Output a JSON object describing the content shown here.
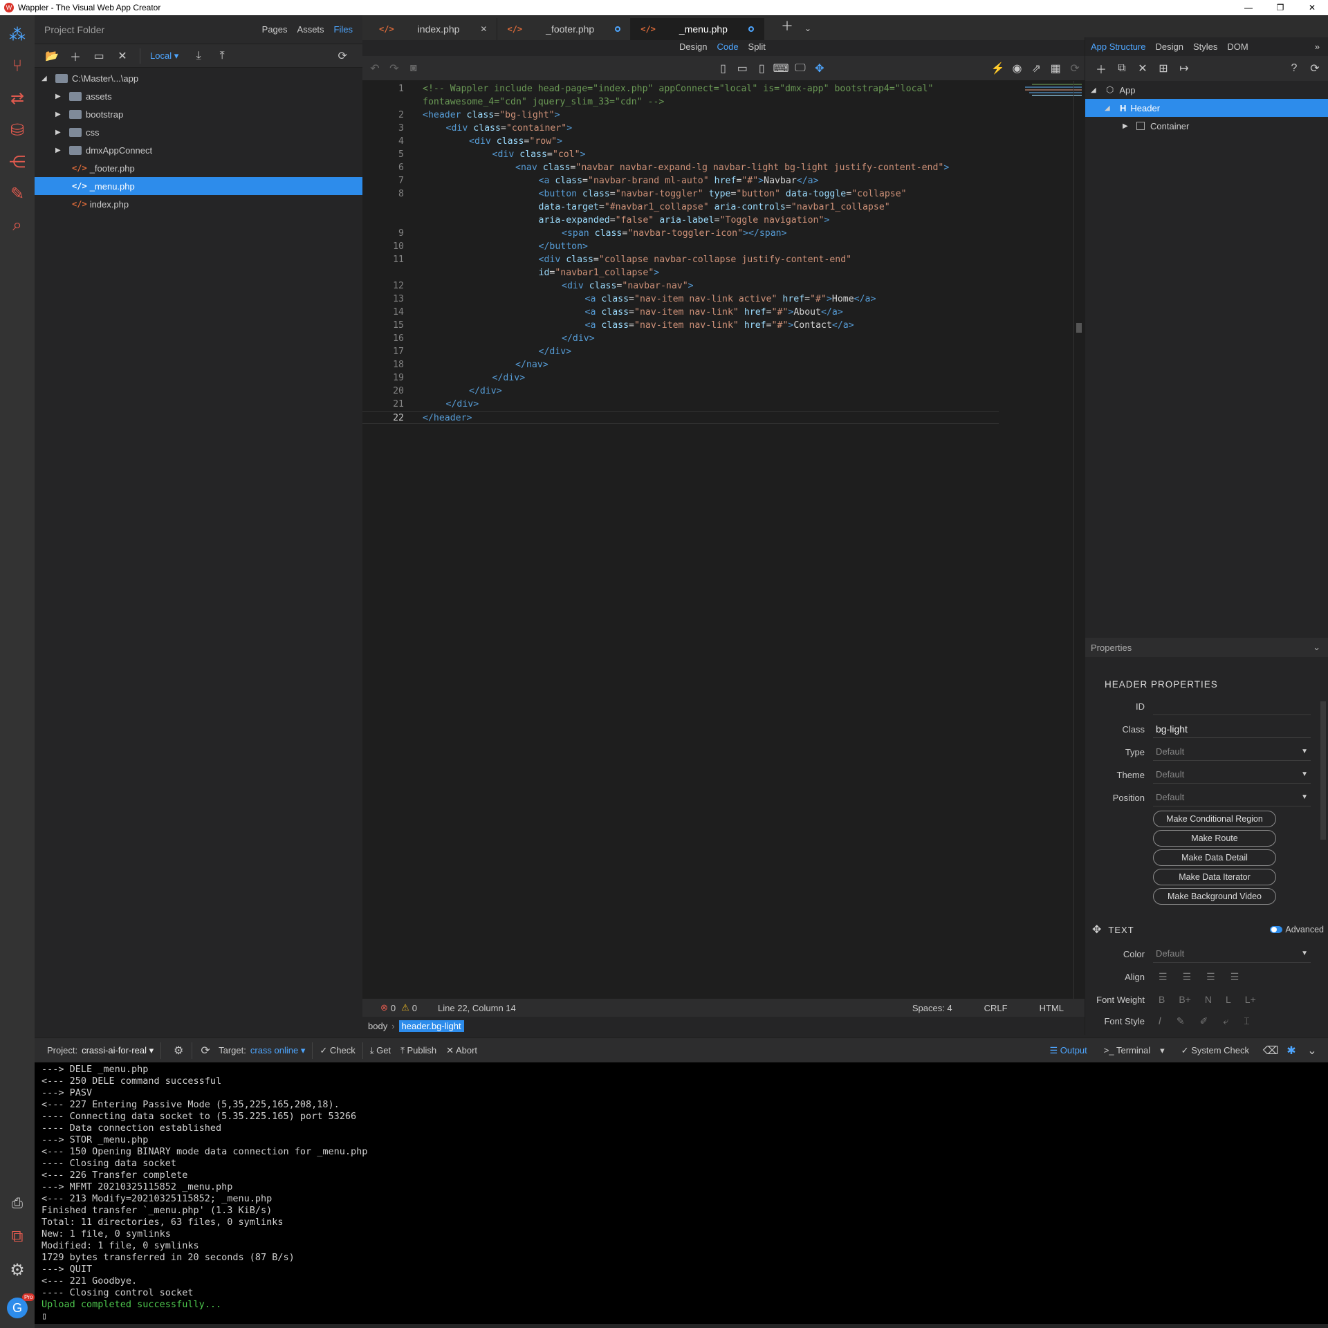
{
  "window": {
    "title": "Wappler - The Visual Web App Creator",
    "min": "—",
    "max": "❐",
    "close": "✕"
  },
  "left_panel": {
    "title": "Project Folder",
    "tabs": [
      "Pages",
      "Assets",
      "Files"
    ],
    "target_select": "Local",
    "tree": [
      {
        "label": "C:\\Master\\...\\app",
        "type": "root"
      },
      {
        "label": "assets",
        "type": "folder"
      },
      {
        "label": "bootstrap",
        "type": "folder"
      },
      {
        "label": "css",
        "type": "folder"
      },
      {
        "label": "dmxAppConnect",
        "type": "folder"
      },
      {
        "label": "_footer.php",
        "type": "file"
      },
      {
        "label": "_menu.php",
        "type": "file",
        "selected": true
      },
      {
        "label": "index.php",
        "type": "file"
      }
    ]
  },
  "editor_tabs": [
    {
      "label": "index.php",
      "state": "close"
    },
    {
      "label": "_footer.php",
      "state": "modified"
    },
    {
      "label": "_menu.php",
      "state": "modified",
      "active": true
    }
  ],
  "view_modes": [
    "Design",
    "Code",
    "Split"
  ],
  "code_lines": [
    {
      "n": "1",
      "indent": 0,
      "html": "<span class='cmt'>&lt;!-- Wappler include head-page=\"index.php\" appConnect=\"local\" is=\"dmx-app\" bootstrap4=\"local\"</span>"
    },
    {
      "n": "",
      "indent": 0,
      "html": "<span class='cmt'>fontawesome_4=\"cdn\" jquery_slim_33=\"cdn\" --&gt;</span>"
    },
    {
      "n": "2",
      "indent": 0,
      "html": "<span class='tag'>&lt;header</span> <span class='attr'>class</span><span class='txt'>=</span><span class='val'>\"bg-light\"</span><span class='tag'>&gt;</span>"
    },
    {
      "n": "3",
      "indent": 1,
      "html": "<span class='tag'>&lt;div</span> <span class='attr'>class</span><span class='txt'>=</span><span class='val'>\"container\"</span><span class='tag'>&gt;</span>"
    },
    {
      "n": "4",
      "indent": 2,
      "html": "<span class='tag'>&lt;div</span> <span class='attr'>class</span><span class='txt'>=</span><span class='val'>\"row\"</span><span class='tag'>&gt;</span>"
    },
    {
      "n": "5",
      "indent": 3,
      "html": "<span class='tag'>&lt;div</span> <span class='attr'>class</span><span class='txt'>=</span><span class='val'>\"col\"</span><span class='tag'>&gt;</span>"
    },
    {
      "n": "6",
      "indent": 4,
      "html": "<span class='tag'>&lt;nav</span> <span class='attr'>class</span><span class='txt'>=</span><span class='val'>\"navbar navbar-expand-lg navbar-light bg-light justify-content-end\"</span><span class='tag'>&gt;</span>"
    },
    {
      "n": "7",
      "indent": 5,
      "html": "<span class='tag'>&lt;a</span> <span class='attr'>class</span><span class='txt'>=</span><span class='val'>\"navbar-brand ml-auto\"</span> <span class='attr'>href</span><span class='txt'>=</span><span class='val'>\"#\"</span><span class='tag'>&gt;</span><span class='txt'>Navbar</span><span class='tag'>&lt;/a&gt;</span>"
    },
    {
      "n": "8",
      "indent": 5,
      "html": "<span class='tag'>&lt;button</span> <span class='attr'>class</span><span class='txt'>=</span><span class='val'>\"navbar-toggler\"</span> <span class='attr'>type</span><span class='txt'>=</span><span class='val'>\"button\"</span> <span class='attr'>data-toggle</span><span class='txt'>=</span><span class='val'>\"collapse\"</span>"
    },
    {
      "n": "",
      "indent": 5,
      "html": "<span class='attr'>data-target</span><span class='txt'>=</span><span class='val'>\"#navbar1_collapse\"</span> <span class='attr'>aria-controls</span><span class='txt'>=</span><span class='val'>\"navbar1_collapse\"</span>"
    },
    {
      "n": "",
      "indent": 5,
      "html": "<span class='attr'>aria-expanded</span><span class='txt'>=</span><span class='val'>\"false\"</span> <span class='attr'>aria-label</span><span class='txt'>=</span><span class='val'>\"Toggle navigation\"</span><span class='tag'>&gt;</span>"
    },
    {
      "n": "9",
      "indent": 6,
      "html": "<span class='tag'>&lt;span</span> <span class='attr'>class</span><span class='txt'>=</span><span class='val'>\"navbar-toggler-icon\"</span><span class='tag'>&gt;&lt;/span&gt;</span>"
    },
    {
      "n": "10",
      "indent": 5,
      "html": "<span class='tag'>&lt;/button&gt;</span>"
    },
    {
      "n": "11",
      "indent": 5,
      "html": "<span class='tag'>&lt;div</span> <span class='attr'>class</span><span class='txt'>=</span><span class='val'>\"collapse navbar-collapse justify-content-end\"</span>"
    },
    {
      "n": "",
      "indent": 5,
      "html": "<span class='attr'>id</span><span class='txt'>=</span><span class='val'>\"navbar1_collapse\"</span><span class='tag'>&gt;</span>"
    },
    {
      "n": "12",
      "indent": 6,
      "html": "<span class='tag'>&lt;div</span> <span class='attr'>class</span><span class='txt'>=</span><span class='val'>\"navbar-nav\"</span><span class='tag'>&gt;</span>"
    },
    {
      "n": "13",
      "indent": 7,
      "html": "<span class='tag'>&lt;a</span> <span class='attr'>class</span><span class='txt'>=</span><span class='val'>\"nav-item nav-link active\"</span> <span class='attr'>href</span><span class='txt'>=</span><span class='val'>\"#\"</span><span class='tag'>&gt;</span><span class='txt'>Home</span><span class='tag'>&lt;/a&gt;</span>"
    },
    {
      "n": "14",
      "indent": 7,
      "html": "<span class='tag'>&lt;a</span> <span class='attr'>class</span><span class='txt'>=</span><span class='val'>\"nav-item nav-link\"</span> <span class='attr'>href</span><span class='txt'>=</span><span class='val'>\"#\"</span><span class='tag'>&gt;</span><span class='txt'>About</span><span class='tag'>&lt;/a&gt;</span>"
    },
    {
      "n": "15",
      "indent": 7,
      "html": "<span class='tag'>&lt;a</span> <span class='attr'>class</span><span class='txt'>=</span><span class='val'>\"nav-item nav-link\"</span> <span class='attr'>href</span><span class='txt'>=</span><span class='val'>\"#\"</span><span class='tag'>&gt;</span><span class='txt'>Contact</span><span class='tag'>&lt;/a&gt;</span>"
    },
    {
      "n": "16",
      "indent": 6,
      "html": "<span class='tag'>&lt;/div&gt;</span>"
    },
    {
      "n": "17",
      "indent": 5,
      "html": "<span class='tag'>&lt;/div&gt;</span>"
    },
    {
      "n": "18",
      "indent": 4,
      "html": "<span class='tag'>&lt;/nav&gt;</span>"
    },
    {
      "n": "19",
      "indent": 3,
      "html": "<span class='tag'>&lt;/div&gt;</span>"
    },
    {
      "n": "20",
      "indent": 2,
      "html": "<span class='tag'>&lt;/div&gt;</span>"
    },
    {
      "n": "21",
      "indent": 1,
      "html": "<span class='tag'>&lt;/div&gt;</span>"
    },
    {
      "n": "22",
      "indent": 0,
      "html": "<span class='tag'>&lt;/header&gt;</span>"
    }
  ],
  "status": {
    "errors": "0",
    "warnings": "0",
    "position": "Line 22, Column 14",
    "spaces": "Spaces: 4",
    "eol": "CRLF",
    "lang": "HTML"
  },
  "breadcrumb": [
    "body",
    "header.bg-light"
  ],
  "right_panel": {
    "tabs": [
      "App Structure",
      "Design",
      "Styles",
      "DOM"
    ],
    "tree": [
      {
        "label": "App"
      },
      {
        "label": "Header",
        "selected": true
      },
      {
        "label": "Container"
      }
    ],
    "properties_title": "Properties",
    "section_title": "HEADER PROPERTIES",
    "fields": [
      {
        "label": "ID",
        "value": "",
        "placeholder": ""
      },
      {
        "label": "Class",
        "value": "bg-light"
      },
      {
        "label": "Type",
        "value": "Default",
        "dropdown": true
      },
      {
        "label": "Theme",
        "value": "Default",
        "dropdown": true
      },
      {
        "label": "Position",
        "value": "Default",
        "dropdown": true
      }
    ],
    "buttons": [
      "Make Conditional Region",
      "Make Route",
      "Make Data Detail",
      "Make Data Iterator",
      "Make Background Video"
    ],
    "text_section": "TEXT",
    "advanced_label": "Advanced",
    "color_label": "Color",
    "color_value": "Default",
    "align_label": "Align",
    "font_weight_label": "Font Weight",
    "font_weight_options": [
      "B",
      "B+",
      "N",
      "L",
      "L+"
    ],
    "font_style_label": "Font Style"
  },
  "bottom_bar": {
    "project_label": "Project:",
    "project_value": "crassi-ai-for-real",
    "target_label": "Target:",
    "target_value": "crass online",
    "actions": [
      "Check",
      "Get",
      "Publish",
      "Abort"
    ],
    "output_tab": "Output",
    "terminal_tab": "Terminal",
    "system_check": "System Check"
  },
  "output_lines": [
    "---> DELE _menu.php",
    "<--- 250 DELE command successful",
    "---> PASV",
    "<--- 227 Entering Passive Mode (5,35,225,165,208,18).",
    "---- Connecting data socket to (5.35.225.165) port 53266",
    "---- Data connection established",
    "---> STOR _menu.php",
    "<--- 150 Opening BINARY mode data connection for _menu.php",
    "---- Closing data socket",
    "<--- 226 Transfer complete",
    "---> MFMT 20210325115852 _menu.php",
    "<--- 213 Modify=20210325115852; _menu.php",
    "Finished transfer `_menu.php' (1.3 KiB/s)",
    "Total: 11 directories, 63 files, 0 symlinks",
    "New: 1 file, 0 symlinks",
    "Modified: 1 file, 0 symlinks",
    "1729 bytes transferred in 20 seconds (87 B/s)",
    "---> QUIT",
    "<--- 221 Goodbye.",
    "---- Closing control socket"
  ],
  "output_success": "Upload completed successfully...",
  "cursor": "▯",
  "badge": "Pro",
  "avatar_letter": "G",
  "colors": {
    "accent": "#2d8ceb",
    "success": "#4ec94e",
    "brand": "#d9332a"
  }
}
